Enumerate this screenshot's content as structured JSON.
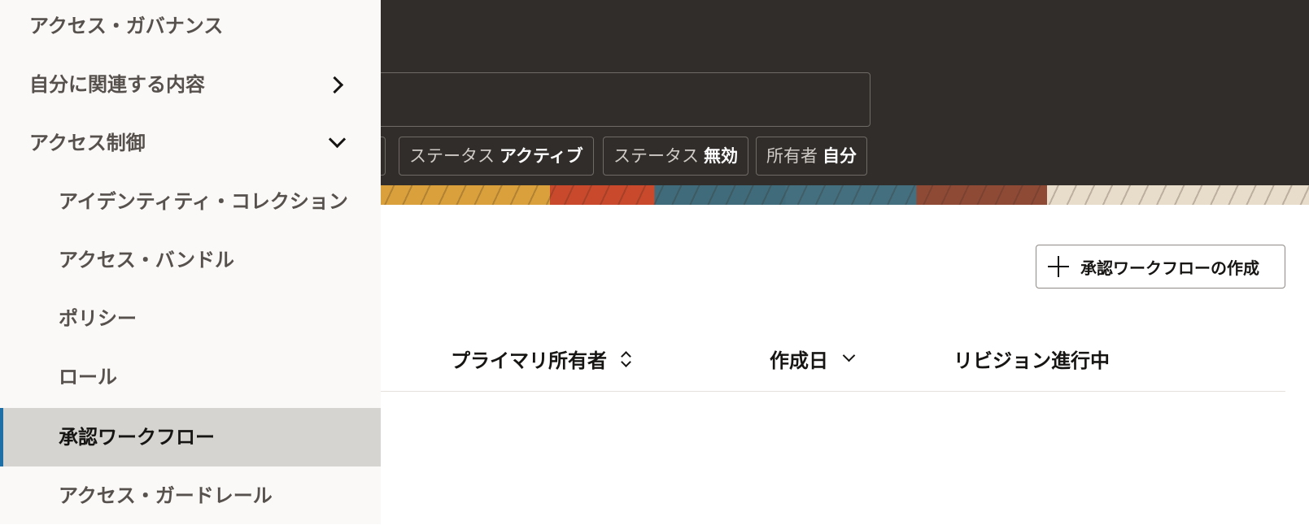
{
  "filters": {
    "chips": [
      {
        "key": "ステータス",
        "value": "アクティブ"
      },
      {
        "key": "ステータス",
        "value": "無効"
      },
      {
        "key": "所有者",
        "value": "自分"
      }
    ]
  },
  "toolbar": {
    "create_label": "承認ワークフローの作成"
  },
  "table": {
    "columns": [
      "プライマリ所有者",
      "作成日",
      "リビジョン進行中"
    ]
  },
  "sidebar": {
    "items": [
      {
        "label": "アクセス・ガバナンス"
      },
      {
        "label": "自分に関連する内容",
        "icon": "chevron-right-icon"
      },
      {
        "label": "アクセス制御",
        "icon": "chevron-down-icon"
      },
      {
        "label": "アイデンティティ・コレクション"
      },
      {
        "label": "アクセス・バンドル"
      },
      {
        "label": "ポリシー"
      },
      {
        "label": "ロール"
      },
      {
        "label": "承認ワークフロー",
        "selected": true
      },
      {
        "label": "アクセス・ガードレール"
      }
    ]
  },
  "colors": {
    "header_bg": "#312d2a",
    "sidebar_bg": "#fbf9f8",
    "selected_bg": "#d6d4d1",
    "selected_accent": "#1d6fa5"
  }
}
